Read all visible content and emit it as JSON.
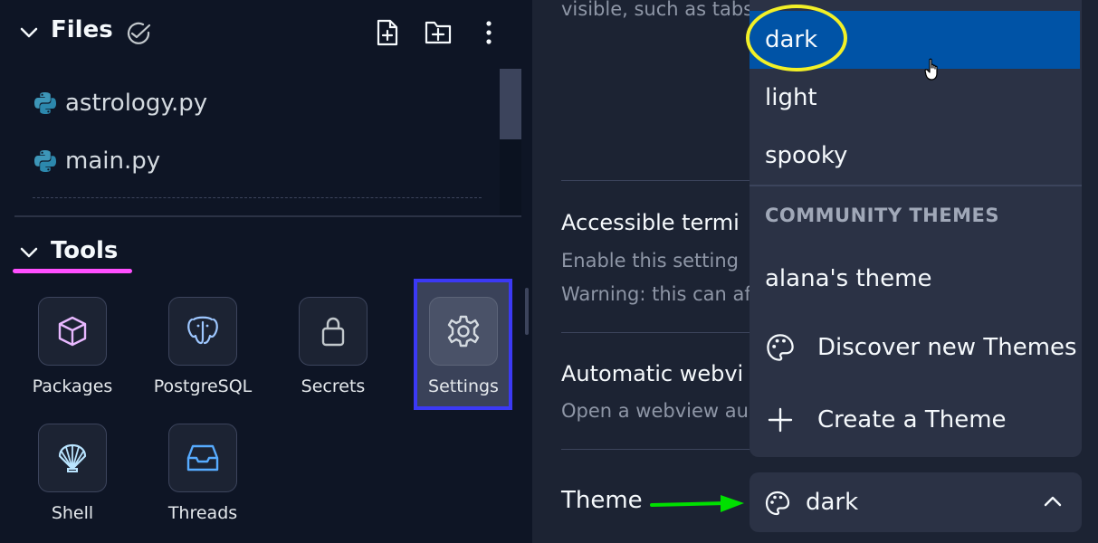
{
  "files": {
    "title": "Files",
    "items": [
      {
        "name": "astrology.py"
      },
      {
        "name": "main.py"
      }
    ]
  },
  "tools": {
    "title": "Tools",
    "items": [
      {
        "label": "Packages"
      },
      {
        "label": "PostgreSQL"
      },
      {
        "label": "Secrets"
      },
      {
        "label": "Settings"
      },
      {
        "label": "Shell"
      },
      {
        "label": "Threads"
      }
    ]
  },
  "settings": {
    "snippet_top": "visible, such as tabs",
    "accessible_terminal": {
      "title": "Accessible termi",
      "desc1": "Enable this setting",
      "desc2": "Warning: this can af"
    },
    "automatic_webview": {
      "title": "Automatic webvi",
      "desc": "Open a webview au"
    },
    "theme": {
      "label": "Theme",
      "value": "dark"
    }
  },
  "theme_menu": {
    "options": [
      "dark",
      "light",
      "spooky"
    ],
    "selected": "dark",
    "community_header": "COMMUNITY THEMES",
    "community_items": [
      "alana's theme"
    ],
    "actions": [
      {
        "label": "Discover new Themes",
        "icon": "palette-icon"
      },
      {
        "label": "Create a Theme",
        "icon": "plus-icon"
      }
    ]
  },
  "colors": {
    "background": "#0e1525",
    "panel": "#1c2333",
    "selected": "#0053a6",
    "highlight_blue": "#3b39f5",
    "highlight_yellow": "#f2f027",
    "underline_pink": "#ff4fff",
    "arrow_green": "#00e000"
  }
}
